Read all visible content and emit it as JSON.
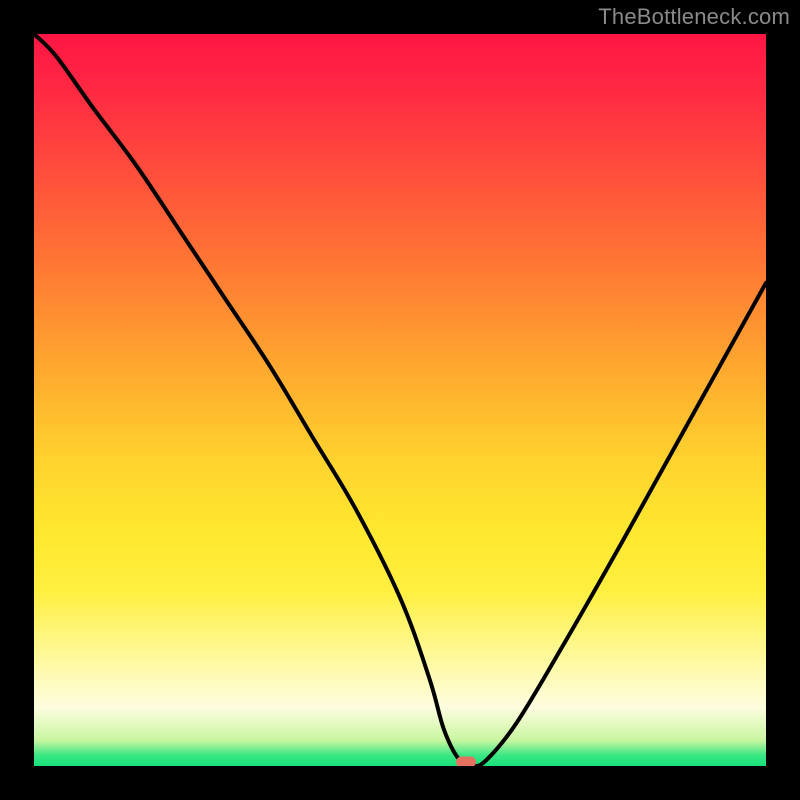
{
  "watermark": "TheBottleneck.com",
  "colors": {
    "frame": "#000000",
    "line": "#000000",
    "marker": "#e47060",
    "gradient_stops": [
      "#ff1545",
      "#ff2a42",
      "#ff4b3d",
      "#ff7234",
      "#ffa62f",
      "#ffd22d",
      "#ffe82f",
      "#ffef3f",
      "#fff99a",
      "#fdfde0",
      "#c9f6a0",
      "#3ce784",
      "#18e07a"
    ]
  },
  "chart_data": {
    "type": "line",
    "title": "",
    "xlabel": "",
    "ylabel": "",
    "xlim": [
      0,
      100
    ],
    "ylim": [
      0,
      100
    ],
    "grid": false,
    "legend": false,
    "notes": "V-shaped bottleneck curve on rainbow heat background. x is relative horizontal position (%), y is relative height of the black curve (% of plot height from bottom). Minimum near x≈58 where y≈0. Marker sits at the trough.",
    "series": [
      {
        "name": "bottleneck-curve",
        "x": [
          0,
          3,
          8,
          14,
          20,
          26,
          32,
          38,
          44,
          50,
          54,
          56,
          58,
          60,
          62,
          66,
          72,
          80,
          90,
          100
        ],
        "y": [
          100,
          97,
          90,
          82,
          73,
          64,
          55,
          45,
          35,
          23,
          12,
          5,
          1,
          0,
          1,
          6,
          16,
          30,
          48,
          66
        ]
      }
    ],
    "marker": {
      "x": 59,
      "y": 0.6
    }
  }
}
